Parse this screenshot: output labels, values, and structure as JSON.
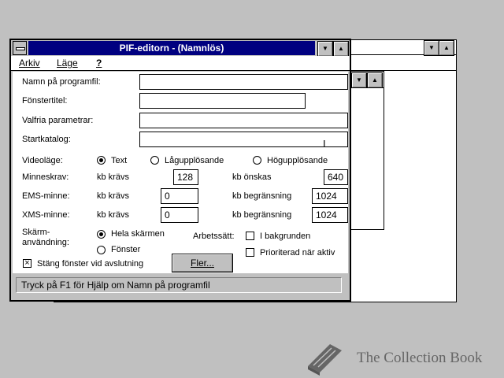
{
  "main_window": {
    "title": "PIF-editorn - (Namnlös)",
    "menu": [
      "Arkiv",
      "Läge",
      "?"
    ],
    "fields": {
      "program_file": {
        "label": "Namn på programfil:",
        "value": ""
      },
      "window_title": {
        "label": "Fönstertitel:",
        "value": ""
      },
      "optional_params": {
        "label": "Valfria parametrar:",
        "value": ""
      },
      "start_dir": {
        "label": "Startkatalog:",
        "value": ""
      }
    },
    "video_mode": {
      "label": "Videoläge:",
      "options": [
        "Text",
        "Lågupplösande",
        "Högupplösande"
      ],
      "selected": "Text"
    },
    "memory": {
      "label": "Minneskrav:",
      "req_label": "kb krävs",
      "req_value": "128",
      "des_label": "kb önskas",
      "des_value": "640"
    },
    "ems": {
      "label": "EMS-minne:",
      "req_label": "kb krävs",
      "req_value": "0",
      "limit_label": "kb begränsning",
      "limit_value": "1024"
    },
    "xms": {
      "label": "XMS-minne:",
      "req_label": "kb krävs",
      "req_value": "0",
      "limit_label": "kb begränsning",
      "limit_value": "1024"
    },
    "screen_usage": {
      "label_line1": "Skärm-",
      "label_line2": "användning:",
      "options": [
        "Hela skärmen",
        "Fönster"
      ],
      "selected": "Hela skärmen"
    },
    "execution": {
      "label": "Arbetssätt:",
      "background": "I bakgrunden",
      "exclusive": "Prioriterad när aktiv"
    },
    "close_on_exit": {
      "label": "Stäng fönster vid avslutning",
      "checked": true
    },
    "more_button": "Fler...",
    "status": "Tryck på F1 för Hjälp om Namn på programfil"
  },
  "watermark": {
    "text": "The Collection Book",
    "icon": "book-icon"
  }
}
